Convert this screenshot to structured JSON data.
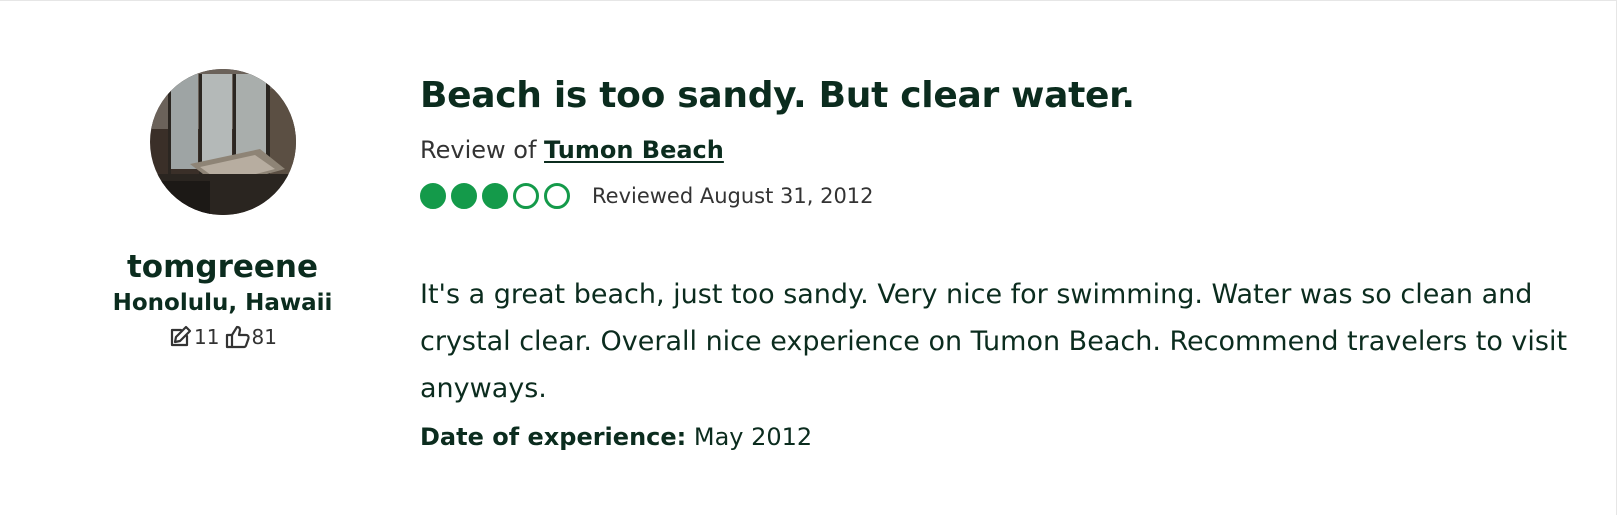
{
  "reviewer": {
    "username": "tomgreene",
    "location": "Honolulu, Hawaii",
    "contributions": "11",
    "helpful_votes": "81",
    "contributions_icon": "pencil-edit-icon",
    "helpful_icon": "thumbs-up-icon"
  },
  "review": {
    "title": "Beach is too sandy. But clear water.",
    "review_of_prefix": "Review of ",
    "attraction_name": "Tumon Beach",
    "rating": 3,
    "rating_max": 5,
    "reviewed_date": "Reviewed August 31, 2012",
    "body": "It's a great beach, just too sandy. Very nice for swimming. Water was so clean and crystal clear. Overall nice experience on Tumon Beach. Recommend travelers to visit anyways.",
    "experience_label": "Date of experience:",
    "experience_value": " May 2012"
  },
  "colors": {
    "brand_green": "#149a4a",
    "text_dark": "#0b2c1e"
  }
}
